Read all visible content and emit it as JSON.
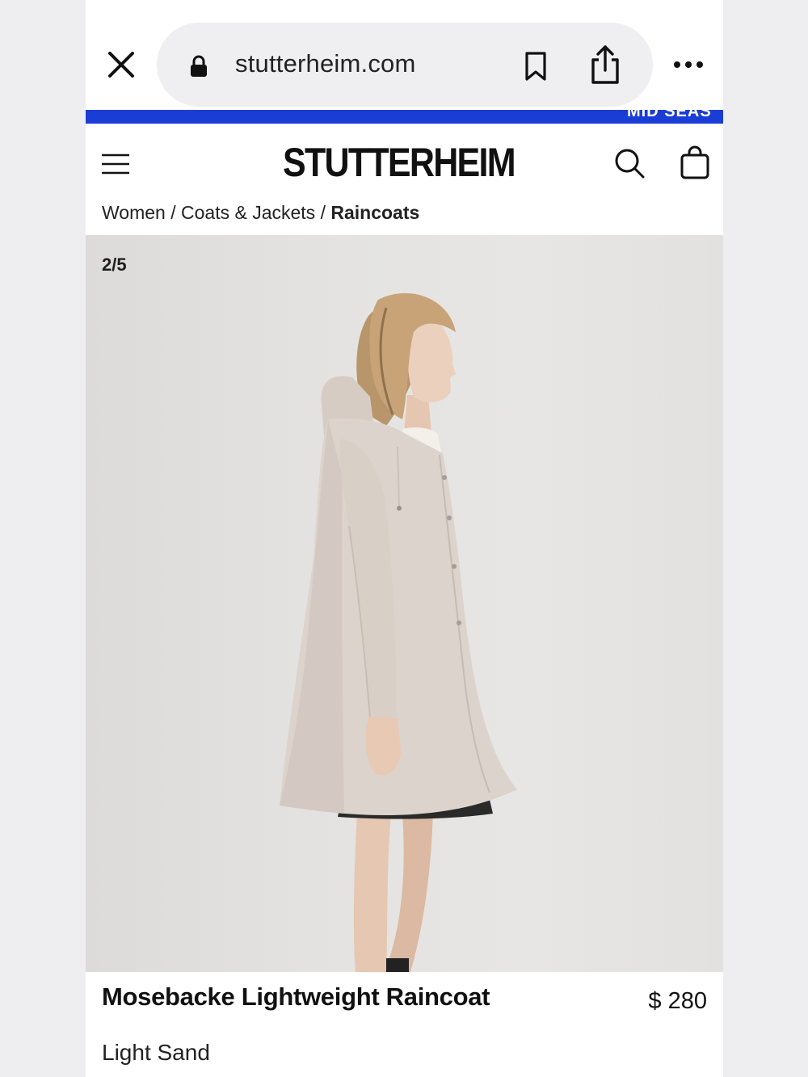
{
  "browser": {
    "url": "stutterheim.com"
  },
  "promo": {
    "text": "MID SEAS"
  },
  "header": {
    "logo": "STUTTERHEIM"
  },
  "breadcrumb": {
    "items": [
      "Women",
      "Coats & Jackets",
      "Raincoats"
    ],
    "separator": " / "
  },
  "gallery": {
    "counter": "2/5"
  },
  "product": {
    "name": "Mosebacke Lightweight Raincoat",
    "color": "Light Sand",
    "price": "$ 280"
  },
  "colors": {
    "promo_bar": "#1a3dd6",
    "coat": "#dcd3cc"
  },
  "icons": [
    "close-icon",
    "lock-icon",
    "bookmark-icon",
    "share-icon",
    "more-icon",
    "menu-icon",
    "search-icon",
    "bag-icon"
  ]
}
